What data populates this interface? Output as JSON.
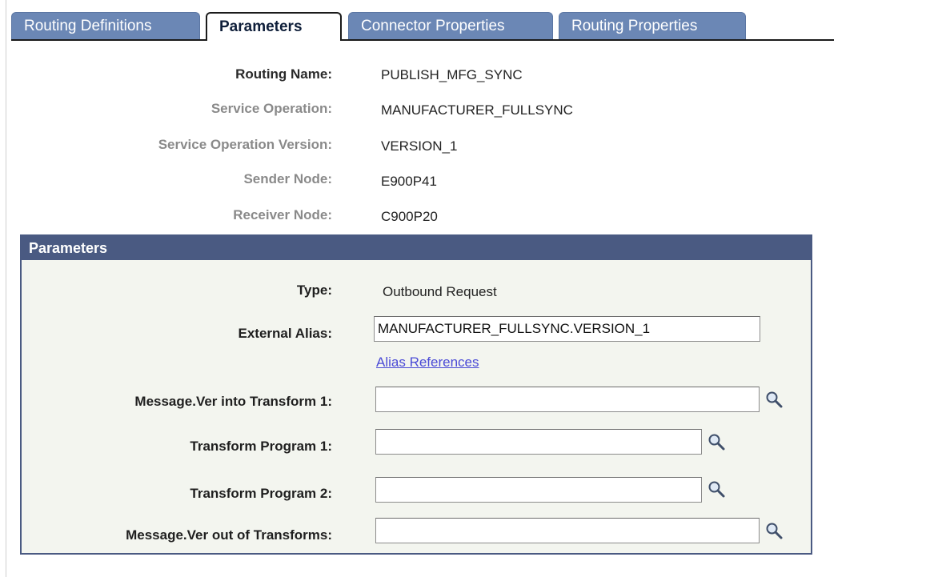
{
  "tabs": [
    {
      "label": "Routing Definitions",
      "active": false
    },
    {
      "label": "Parameters",
      "active": true
    },
    {
      "label": "Connector Properties",
      "active": false
    },
    {
      "label": "Routing Properties",
      "active": false
    }
  ],
  "info": {
    "routing_name_label": "Routing Name:",
    "routing_name_value": "PUBLISH_MFG_SYNC",
    "service_operation_label": "Service Operation:",
    "service_operation_value": "MANUFACTURER_FULLSYNC",
    "service_operation_version_label": "Service Operation Version:",
    "service_operation_version_value": "VERSION_1",
    "sender_node_label": "Sender Node:",
    "sender_node_value": "E900P41",
    "receiver_node_label": "Receiver Node:",
    "receiver_node_value": "C900P20"
  },
  "parameters": {
    "header": "Parameters",
    "type_label": "Type:",
    "type_value": "Outbound Request",
    "external_alias_label": "External Alias:",
    "external_alias_value": "MANUFACTURER_FULLSYNC.VERSION_1",
    "alias_references_link": "Alias References",
    "msg_into_transform_label": "Message.Ver into Transform 1:",
    "msg_into_transform_value": "",
    "transform_program_1_label": "Transform Program 1:",
    "transform_program_1_value": "",
    "transform_program_2_label": "Transform Program 2:",
    "transform_program_2_value": "",
    "msg_out_transforms_label": "Message.Ver out of Transforms:",
    "msg_out_transforms_value": ""
  },
  "icons": {
    "lookup": "magnifier-lookup-icon"
  },
  "colors": {
    "tab": "#6b87b5",
    "group_header": "#4a5a82",
    "link": "#4a4ad6",
    "group_bg": "#f3f5ef"
  }
}
